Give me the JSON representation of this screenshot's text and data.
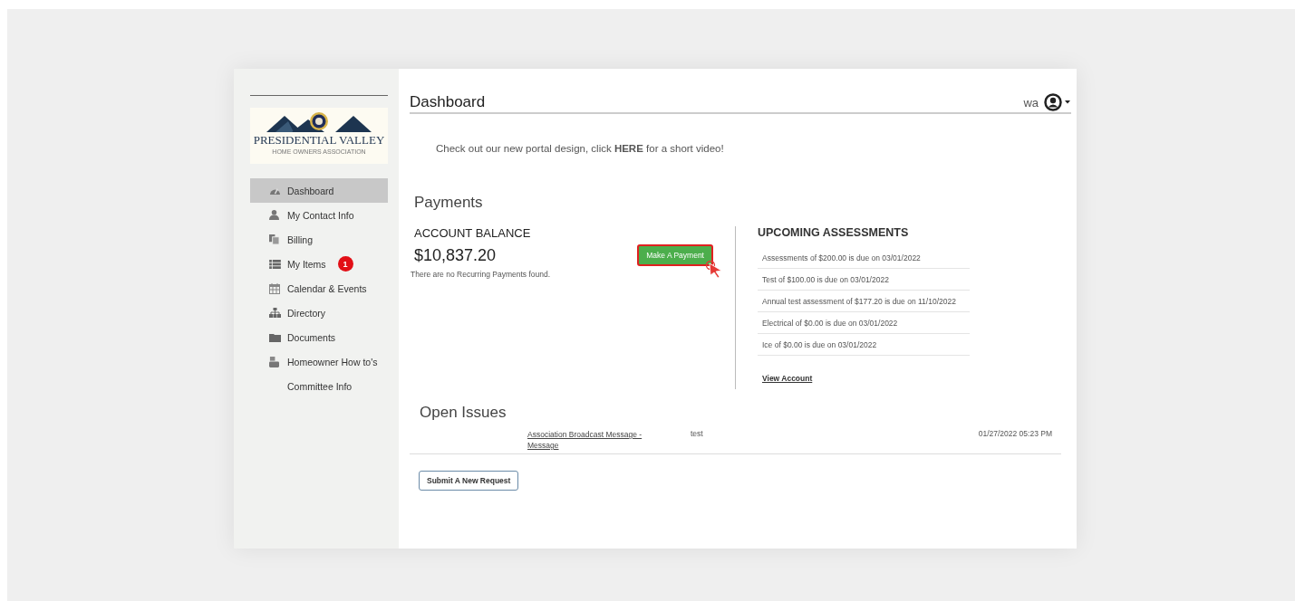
{
  "logo": {
    "title": "PRESIDENTIAL VALLEY",
    "subtitle": "HOME OWNERS ASSOCIATION"
  },
  "sidebar": {
    "items": [
      {
        "label": "Dashboard",
        "kind": "gauge",
        "selected": true
      },
      {
        "label": "My Contact Info",
        "kind": "user",
        "selected": false
      },
      {
        "label": "Billing",
        "kind": "copy",
        "selected": false
      },
      {
        "label": "My Items",
        "kind": "list",
        "selected": false,
        "badge": "1"
      },
      {
        "label": "Calendar & Events",
        "kind": "calendar",
        "selected": false
      },
      {
        "label": "Directory",
        "kind": "sitemap",
        "selected": false
      },
      {
        "label": "Documents",
        "kind": "folder",
        "selected": false
      },
      {
        "label": "Homeowner How to's",
        "kind": "video",
        "selected": false
      },
      {
        "label": "Committee Info",
        "kind": "plain",
        "selected": false
      }
    ]
  },
  "header": {
    "title": "Dashboard",
    "user": "wa"
  },
  "notice": "Check out our new portal design, click **HERE** for a short video!",
  "payments": {
    "title": "Payments",
    "balance_label": "ACCOUNT BALANCE",
    "balance": "$10,837.20",
    "recurring_note": "There are no Recurring Payments found.",
    "pay_button": "Make A Payment",
    "assessments_title": "UPCOMING ASSESSMENTS",
    "assessments": [
      "Assessments of $200.00 is due on 03/01/2022",
      "Test of $100.00 is due on 03/01/2022",
      "Annual test assessment of $177.20 is due on 11/10/2022",
      "Electrical of $0.00 is due on 03/01/2022",
      "Ice of $0.00 is due on 03/01/2022"
    ],
    "view_account": "View Account"
  },
  "open_issues": {
    "title": "Open Issues",
    "rows": [
      {
        "subject": "Association Broadcast Message - Message",
        "description": "test",
        "date": "01/27/2022 05:23 PM"
      }
    ],
    "submit_button": "Submit A New Request"
  }
}
